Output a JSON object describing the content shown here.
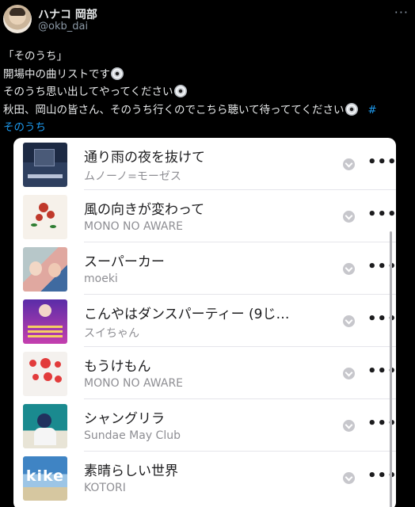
{
  "header": {
    "display_name": "ハナコ 岡部",
    "handle": "@okb_dai",
    "more_label": "···"
  },
  "tweet": {
    "line1": "「そのうち」",
    "line2": "開場中の曲リストです",
    "line3": "そのうち思い出してやってください",
    "line4": "秋田、岡山の皆さん、そのうち行くのでこちら聴いて待っててください",
    "hashtag_a": "#",
    "hashtag_b": "そのうち",
    "emoji_icon": "disc-icon"
  },
  "playlist": {
    "tracks": [
      {
        "title": "通り雨の夜を抜けて",
        "artist": "ムノーノ=モーゼス"
      },
      {
        "title": "風の向きが変わって",
        "artist": "MONO NO AWARE"
      },
      {
        "title": "スーパーカー",
        "artist": "moeki"
      },
      {
        "title": "こんやはダンスパーティー (9じ…",
        "artist": "スイちゃん"
      },
      {
        "title": "もうけもん",
        "artist": "MONO NO AWARE"
      },
      {
        "title": "シャングリラ",
        "artist": "Sundae May Club"
      },
      {
        "title": "素晴らしい世界",
        "artist": "KOTORI",
        "art_text": "kike"
      }
    ],
    "download_icon": "download-icon",
    "more_label": "•••"
  }
}
